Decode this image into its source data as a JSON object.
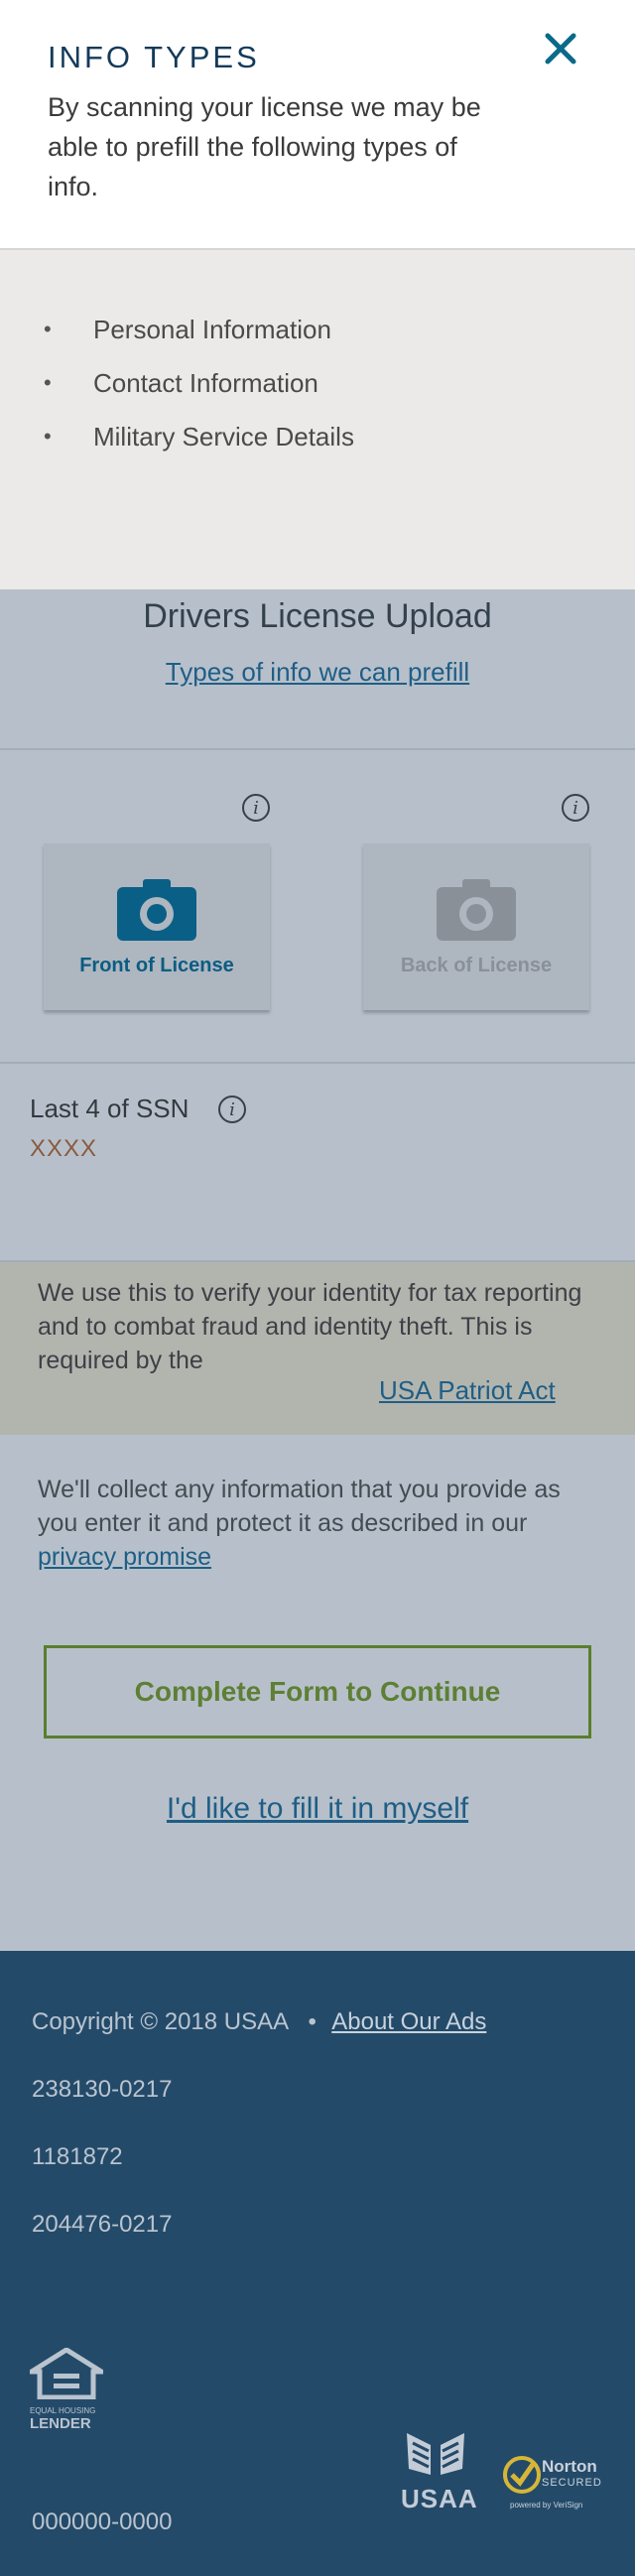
{
  "modal": {
    "title": "INFO TYPES",
    "description": "By scanning your license we may be able to prefill the following types of info.",
    "items": [
      "Personal Information",
      "Contact Information",
      "Military Service Details"
    ]
  },
  "page": {
    "title": "Drivers License Upload",
    "prefill_link": "Types of info we can prefill",
    "front_label": "Front of License",
    "back_label": "Back of License",
    "ssn_label": "Last 4 of SSN",
    "ssn_placeholder": "XXXX",
    "notice_text": "We use this to verify your identity for tax reporting and to combat fraud and identity theft. This is required by the",
    "patriot_link": "USA Patriot Act",
    "collect_text": "We'll collect any information that you provide as you enter it and protect it as described in our",
    "privacy_link": "privacy promise",
    "complete_button": "Complete Form to Continue",
    "self_link": "I'd like to fill it in myself"
  },
  "footer": {
    "copyright": "Copyright © 2018 USAA",
    "separator": "•",
    "about_link": "About Our Ads",
    "codes": [
      "238130-0217",
      "1181872",
      "204476-0217"
    ],
    "phone": "000000-0000",
    "equal_housing_line1": "EQUAL HOUSING",
    "equal_housing_line2": "LENDER",
    "usaa_logo": "USAA",
    "norton_title": "Norton",
    "norton_secured": "SECURED",
    "norton_powered": "powered by VeriSign"
  },
  "colors": {
    "brand_blue": "#0a5f86",
    "footer_bg": "#244a69",
    "button_green": "#5a7f2c"
  }
}
